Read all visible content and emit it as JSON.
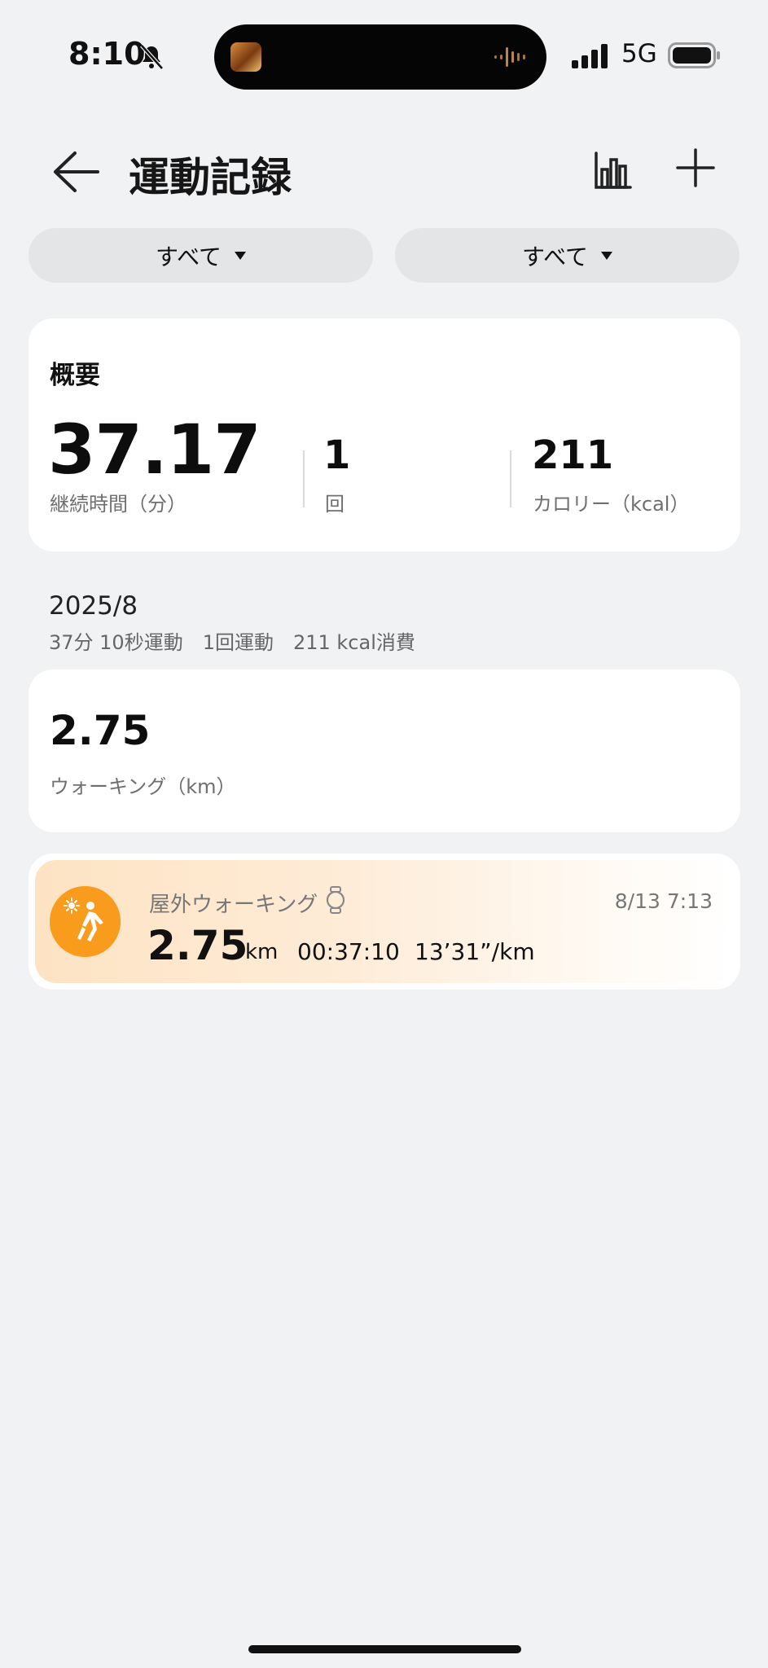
{
  "status_bar": {
    "time": "8:10",
    "network": "5G"
  },
  "header": {
    "title": "運動記録"
  },
  "filters": [
    {
      "label": "すべて"
    },
    {
      "label": "すべて"
    }
  ],
  "summary": {
    "title": "概要",
    "stats": [
      {
        "value": "37.17",
        "label": "継続時間（分）"
      },
      {
        "value": "1",
        "label": "回"
      },
      {
        "value": "211",
        "label": "カロリー（kcal）"
      }
    ]
  },
  "month": {
    "label": "2025/8",
    "summary": "37分 10秒運動　1回運動　211 kcal消費"
  },
  "walking_total": {
    "value": "2.75",
    "label": "ウォーキング（km）"
  },
  "activities": [
    {
      "name": "屋外ウォーキング",
      "datetime": "8/13 7:13",
      "distance": "2.75",
      "distance_unit": "km",
      "duration": "00:37:10",
      "pace": "13’31”/km",
      "icon": "outdoor-walking-icon",
      "icon_color": "#f99b1c",
      "source_icon": "watch-icon"
    }
  ],
  "colors": {
    "background": "#f1f2f4",
    "card": "#ffffff",
    "accent": "#f99b1c"
  }
}
